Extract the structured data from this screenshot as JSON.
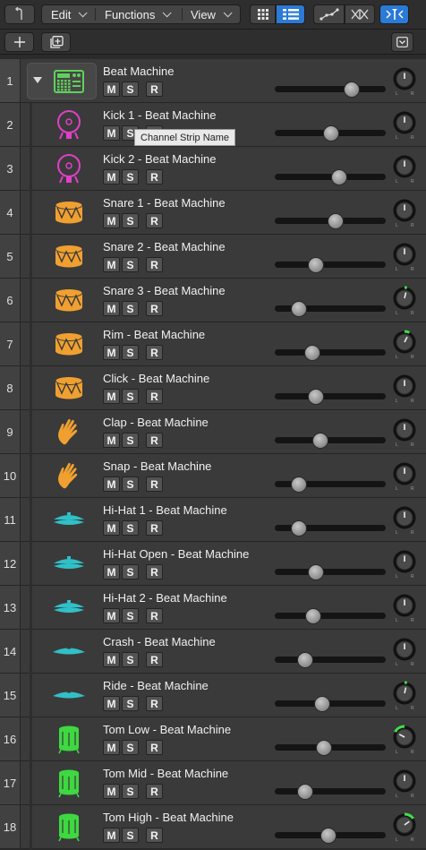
{
  "toolbar": {
    "menus": [
      {
        "label": "Edit"
      },
      {
        "label": "Functions"
      },
      {
        "label": "View"
      }
    ]
  },
  "tooltip": "Channel Strip Name",
  "button_labels": {
    "mute": "M",
    "solo": "S",
    "record": "R"
  },
  "tracks": [
    {
      "number": "1",
      "name": "Beat Machine",
      "icon": "drum-machine-icon",
      "color": "#5fd15a",
      "fader": 0.69,
      "pan": 0.0,
      "folder": true
    },
    {
      "number": "2",
      "name": "Kick 1 - Beat Machine",
      "icon": "kick-drum-icon",
      "color": "#e040c8",
      "fader": 0.51,
      "pan": 0.0
    },
    {
      "number": "3",
      "name": "Kick 2 - Beat Machine",
      "icon": "kick-drum-icon",
      "color": "#e040c8",
      "fader": 0.58,
      "pan": 0.0
    },
    {
      "number": "4",
      "name": "Snare 1 - Beat Machine",
      "icon": "snare-drum-icon",
      "color": "#f0a030",
      "fader": 0.55,
      "pan": 0.0
    },
    {
      "number": "5",
      "name": "Snare 2 - Beat Machine",
      "icon": "snare-drum-icon",
      "color": "#f0a030",
      "fader": 0.37,
      "pan": 0.0
    },
    {
      "number": "6",
      "name": "Snare 3 - Beat Machine",
      "icon": "snare-drum-icon",
      "color": "#f0a030",
      "fader": 0.22,
      "pan": 0.1
    },
    {
      "number": "7",
      "name": "Rim - Beat Machine",
      "icon": "snare-drum-icon",
      "color": "#f0a030",
      "fader": 0.34,
      "pan": 0.2
    },
    {
      "number": "8",
      "name": "Click - Beat Machine",
      "icon": "snare-drum-icon",
      "color": "#f0a030",
      "fader": 0.37,
      "pan": 0.0
    },
    {
      "number": "9",
      "name": "Clap - Beat Machine",
      "icon": "clap-hand-icon",
      "color": "#f0a030",
      "fader": 0.41,
      "pan": 0.0
    },
    {
      "number": "10",
      "name": "Snap - Beat Machine",
      "icon": "clap-hand-icon",
      "color": "#f0a030",
      "fader": 0.22,
      "pan": 0.0
    },
    {
      "number": "11",
      "name": "Hi-Hat 1 - Beat Machine",
      "icon": "hihat-icon",
      "color": "#30c0c8",
      "fader": 0.22,
      "pan": 0.0
    },
    {
      "number": "12",
      "name": "Hi-Hat Open - Beat Machine",
      "icon": "hihat-icon",
      "color": "#30c0c8",
      "fader": 0.37,
      "pan": 0.0
    },
    {
      "number": "13",
      "name": "Hi-Hat 2 - Beat Machine",
      "icon": "hihat-icon",
      "color": "#30c0c8",
      "fader": 0.35,
      "pan": 0.0
    },
    {
      "number": "14",
      "name": "Crash - Beat Machine",
      "icon": "cymbal-icon",
      "color": "#30c0c8",
      "fader": 0.27,
      "pan": 0.0
    },
    {
      "number": "15",
      "name": "Ride - Beat Machine",
      "icon": "cymbal-icon",
      "color": "#30c0c8",
      "fader": 0.43,
      "pan": 0.1
    },
    {
      "number": "16",
      "name": "Tom Low - Beat Machine",
      "icon": "tom-drum-icon",
      "color": "#3ed840",
      "fader": 0.44,
      "pan": -0.45
    },
    {
      "number": "17",
      "name": "Tom Mid - Beat Machine",
      "icon": "tom-drum-icon",
      "color": "#3ed840",
      "fader": 0.27,
      "pan": 0.0
    },
    {
      "number": "18",
      "name": "Tom High - Beat Machine",
      "icon": "tom-drum-icon",
      "color": "#3ed840",
      "fader": 0.48,
      "pan": 0.4
    }
  ]
}
